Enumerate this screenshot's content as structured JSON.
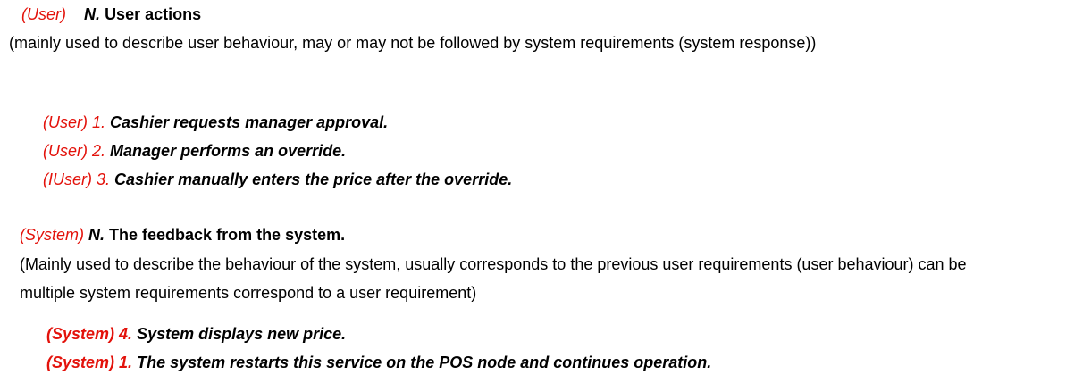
{
  "user_section": {
    "tag": "(User)",
    "marker": "N.",
    "title": "User actions",
    "description": "(mainly used to describe user behaviour, may or may not be followed by system requirements (system response))",
    "items": [
      {
        "tag": "(User)",
        "number": "1.",
        "text": "Cashier requests manager approval."
      },
      {
        "tag": "(User)",
        "number": "2.",
        "text": "Manager performs an override."
      },
      {
        "tag": "(IUser)",
        "number": "3.",
        "text": "Cashier manually enters the price after the override."
      }
    ]
  },
  "system_section": {
    "tag": "(System)",
    "marker": "N.",
    "title": "The feedback from the system.",
    "description_line_1": "(Mainly used to describe the behaviour of the system, usually corresponds to the previous user requirements (user behaviour) can be",
    "description_line_2": "multiple system requirements correspond to a user requirement)",
    "items": [
      {
        "tag": "(System)",
        "number": "4.",
        "text": "System displays new price."
      },
      {
        "tag": "(System)",
        "number": "1.",
        "text": "The system restarts this service on the POS node and continues operation."
      }
    ]
  },
  "colors": {
    "tag_red": "#e3120b",
    "text": "#000000",
    "background": "#ffffff"
  }
}
